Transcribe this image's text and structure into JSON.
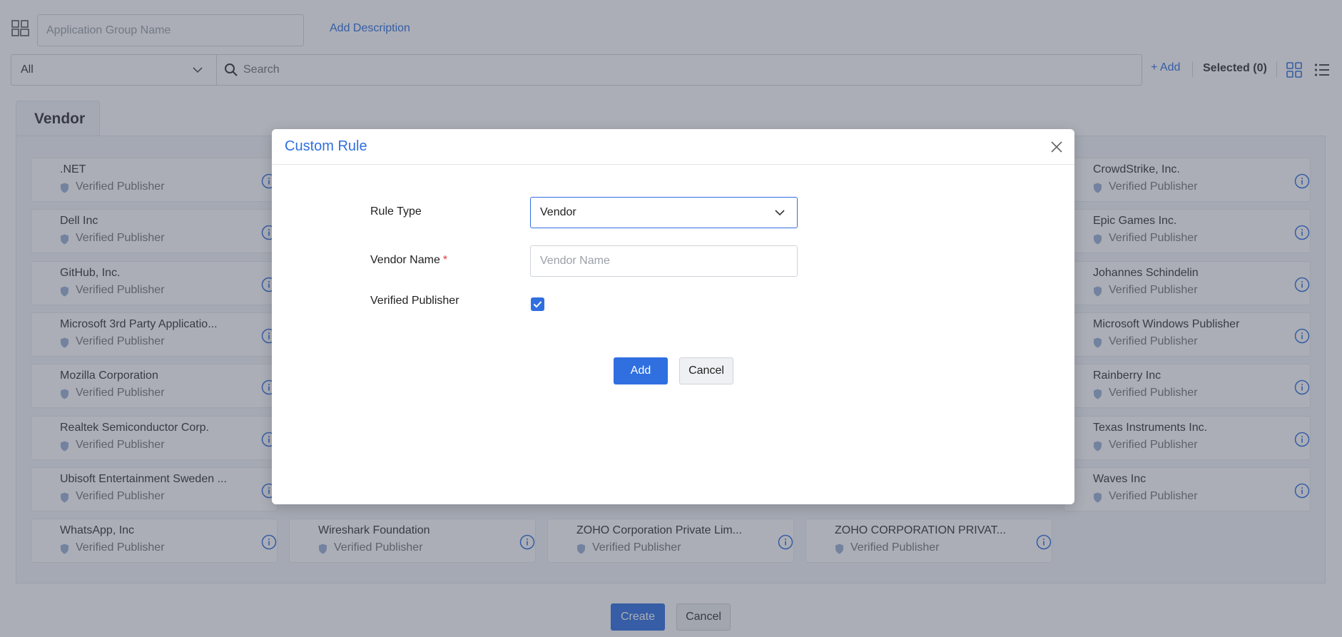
{
  "header": {
    "group_name_placeholder": "Application Group Name",
    "add_description": "Add Description"
  },
  "filter": {
    "selected": "All",
    "search_placeholder": "Search",
    "add_label": "+ Add",
    "selected_label": "Selected (0)"
  },
  "tab": {
    "label": "Vendor"
  },
  "vendors": [
    {
      "name": ".NET",
      "publisher": "Verified Publisher"
    },
    {
      "name": "CrowdStrike, Inc.",
      "publisher": "Verified Publisher"
    },
    {
      "name": "Dell Inc",
      "publisher": "Verified Publisher"
    },
    {
      "name": "Epic Games Inc.",
      "publisher": "Verified Publisher"
    },
    {
      "name": "GitHub, Inc.",
      "publisher": "Verified Publisher"
    },
    {
      "name": "Johannes Schindelin",
      "publisher": "Verified Publisher"
    },
    {
      "name": "Microsoft 3rd Party Applicatio...",
      "publisher": "Verified Publisher"
    },
    {
      "name": "Microsoft Windows Publisher",
      "publisher": "Verified Publisher"
    },
    {
      "name": "Mozilla Corporation",
      "publisher": "Verified Publisher"
    },
    {
      "name": "Rainberry Inc",
      "publisher": "Verified Publisher"
    },
    {
      "name": "Realtek Semiconductor Corp.",
      "publisher": "Verified Publisher"
    },
    {
      "name": "Texas Instruments Inc.",
      "publisher": "Verified Publisher"
    },
    {
      "name": "Ubisoft Entertainment Sweden ...",
      "publisher": "Verified Publisher"
    },
    {
      "name": "Waves Inc",
      "publisher": "Verified Publisher"
    },
    {
      "name": "WhatsApp, Inc",
      "publisher": "Verified Publisher"
    },
    {
      "name": "Wireshark Foundation",
      "publisher": "Verified Publisher"
    },
    {
      "name": "ZOHO Corporation Private Lim...",
      "publisher": "Verified Publisher"
    },
    {
      "name": "ZOHO CORPORATION PRIVAT...",
      "publisher": "Verified Publisher"
    }
  ],
  "footer": {
    "create_label": "Create",
    "cancel_label": "Cancel"
  },
  "modal": {
    "title": "Custom Rule",
    "rule_type_label": "Rule Type",
    "rule_type_value": "Vendor",
    "vendor_name_label": "Vendor Name",
    "vendor_name_required": "*",
    "vendor_name_placeholder": "Vendor Name",
    "verified_publisher_label": "Verified Publisher",
    "verified_publisher_checked": true,
    "add_label": "Add",
    "cancel_label": "Cancel"
  },
  "colors": {
    "accent": "#2f6fe0",
    "required": "#e23b3b",
    "overlay": "rgba(63,70,88,0.44)"
  },
  "icons": {
    "app": "app-grid-icon",
    "search": "search-icon",
    "chevron": "chevron-down-icon",
    "grid_view": "grid-view-icon",
    "list_view": "list-view-icon",
    "shield": "shield-icon",
    "info": "info-icon",
    "close": "close-icon",
    "check": "check-icon"
  }
}
